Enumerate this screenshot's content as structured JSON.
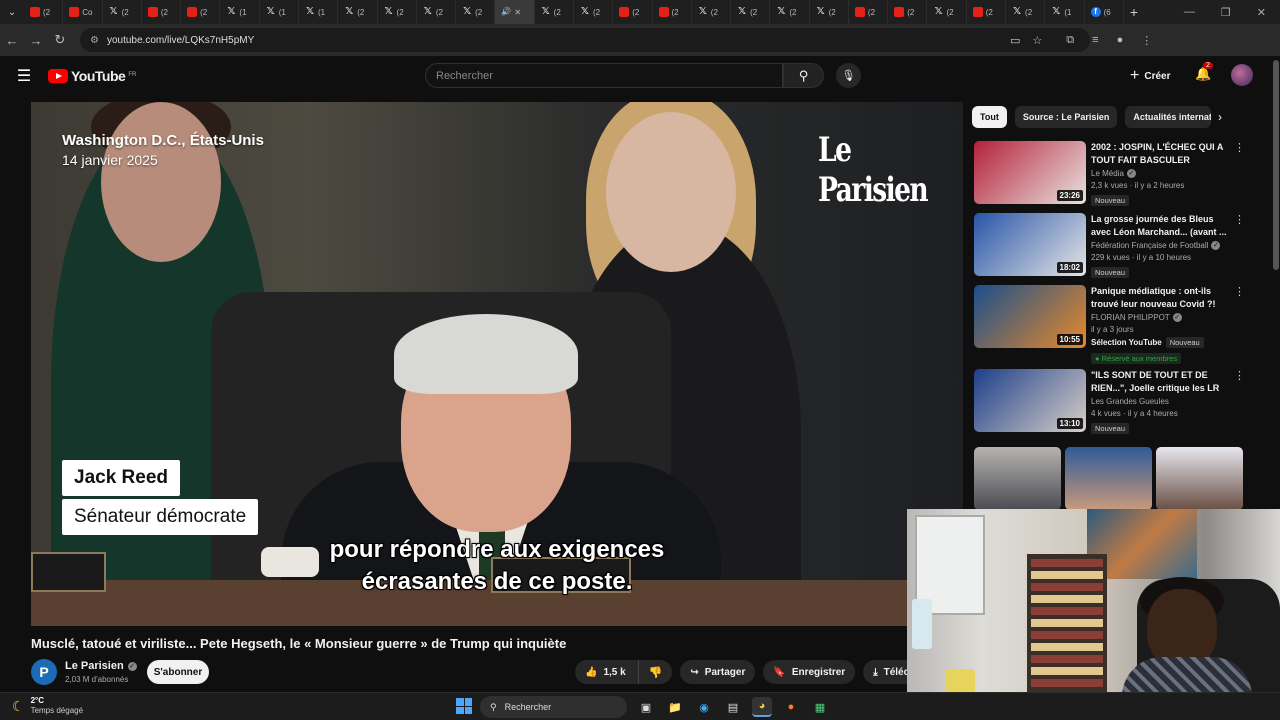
{
  "browser": {
    "tabs": [
      {
        "icon": "youtube",
        "label": "(2"
      },
      {
        "icon": "youtube",
        "label": "Co"
      },
      {
        "icon": "x",
        "label": "(2"
      },
      {
        "icon": "youtube",
        "label": "(2"
      },
      {
        "icon": "youtube",
        "label": "(2"
      },
      {
        "icon": "x",
        "label": "(1"
      },
      {
        "icon": "x",
        "label": "(1"
      },
      {
        "icon": "x",
        "label": "(1"
      },
      {
        "icon": "x",
        "label": "(2"
      },
      {
        "icon": "x",
        "label": "(2"
      },
      {
        "icon": "x",
        "label": "(2"
      },
      {
        "icon": "x",
        "label": "(2"
      },
      {
        "icon": "sound",
        "label": "✕",
        "active": true
      },
      {
        "icon": "x",
        "label": "(2"
      },
      {
        "icon": "x",
        "label": "(2"
      },
      {
        "icon": "youtube",
        "label": "(2"
      },
      {
        "icon": "youtube",
        "label": "(2"
      },
      {
        "icon": "x",
        "label": "(2"
      },
      {
        "icon": "x",
        "label": "(2"
      },
      {
        "icon": "x",
        "label": "(2"
      },
      {
        "icon": "x",
        "label": "(2"
      },
      {
        "icon": "youtube",
        "label": "(2"
      },
      {
        "icon": "youtube",
        "label": "(2"
      },
      {
        "icon": "x",
        "label": "(2"
      },
      {
        "icon": "youtube",
        "label": "(2"
      },
      {
        "icon": "x",
        "label": "(2"
      },
      {
        "icon": "x",
        "label": "(1"
      },
      {
        "icon": "facebook",
        "label": "(6"
      }
    ],
    "url": "youtube.com/live/LQKs7nH5pMY"
  },
  "header": {
    "logo_text": "YouTube",
    "logo_region": "FR",
    "search_placeholder": "Rechercher",
    "create_label": "Créer",
    "notifications_count": "2"
  },
  "video": {
    "location": "Washington D.C., États-Unis",
    "date": "14 janvier 2025",
    "brand": "Le Parisien",
    "lower_third_name": "Jack Reed",
    "lower_third_role": "Sénateur démocrate",
    "caption_line1": "pour répondre aux exigences",
    "caption_line2": "écrasantes de ce poste."
  },
  "details": {
    "title": "Musclé, tatoué et viriliste... Pete Hegseth, le « Monsieur guerre » de Trump qui inquiète",
    "channel_name": "Le Parisien",
    "channel_initial": "P",
    "subscribers": "2,03 M d'abonnés",
    "subscribe_label": "S'abonner",
    "likes": "1,5 k",
    "share_label": "Partager",
    "save_label": "Enregistrer",
    "download_label": "Télécharger"
  },
  "sidebar": {
    "chips": [
      "Tout",
      "Source : Le Parisien",
      "Actualités internationales"
    ],
    "recommendations": [
      {
        "title": "2002 : JOSPIN, L'ÉCHEC QUI A TOUT FAIT BASCULER",
        "channel": "Le Média",
        "verified": true,
        "meta": "2,3 k vues · il y a 2 heures",
        "badge": "Nouveau",
        "duration": "23:26",
        "thumb_colors": [
          "#b4213a",
          "#e9e3df"
        ]
      },
      {
        "title": "La grosse journée des Bleus avec Léon Marchand... (avant ...",
        "channel": "Fédération Française de Football",
        "verified": true,
        "meta": "229 k vues · il y a 10 heures",
        "badge": "Nouveau",
        "duration": "18:02",
        "thumb_colors": [
          "#2755a8",
          "#e6e6e6"
        ]
      },
      {
        "title": "Panique médiatique : ont-ils trouvé leur nouveau Covid ?!",
        "channel": "FLORIAN PHILIPPOT",
        "verified": true,
        "meta": "il y a 3 jours",
        "selection": "Sélection YouTube",
        "badge": "Nouveau",
        "members": "Réservé aux membres",
        "duration": "10:55",
        "thumb_colors": [
          "#1a4f8c",
          "#e8892a"
        ]
      },
      {
        "title": "\"ILS SONT DE TOUT ET DE RIEN...\", Joelle critique les LR",
        "channel": "Les Grandes Gueules",
        "verified": false,
        "meta": "4 k vues · il y a 4 heures",
        "badge": "Nouveau",
        "duration": "13:10",
        "thumb_colors": [
          "#1c3f8a",
          "#d8cfc8"
        ]
      }
    ]
  },
  "taskbar": {
    "temperature": "2°C",
    "weather": "Temps dégagé",
    "search_label": "Rechercher"
  },
  "colors": {
    "background": "#0f0f0f",
    "accent_red": "#ff0000",
    "chip_active": "#f1f1f1",
    "brand_blue": "#1d6ab5"
  }
}
